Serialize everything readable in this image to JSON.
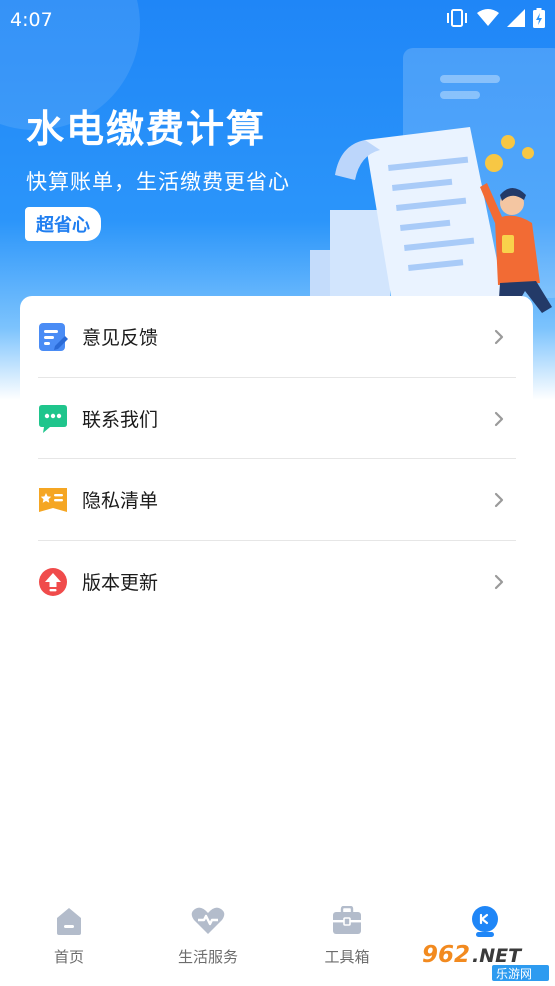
{
  "status_bar": {
    "time": "4:07",
    "icons": [
      "vibrate-icon",
      "wifi-icon",
      "signal-icon",
      "battery-icon"
    ]
  },
  "hero": {
    "title": "水电缴费计算",
    "subtitle": "快算账单，生活缴费更省心",
    "badge": "超省心"
  },
  "menu": {
    "items": [
      {
        "label": "意见反馈",
        "icon": "feedback-icon",
        "color": "#4a8cf5"
      },
      {
        "label": "联系我们",
        "icon": "chat-icon",
        "color": "#1fc58c"
      },
      {
        "label": "隐私清单",
        "icon": "privacy-list-icon",
        "color": "#f5a623"
      },
      {
        "label": "版本更新",
        "icon": "update-icon",
        "color": "#f04b4b"
      }
    ]
  },
  "tabs": [
    {
      "label": "首页",
      "icon": "home-icon"
    },
    {
      "label": "生活服务",
      "icon": "life-service-icon"
    },
    {
      "label": "工具箱",
      "icon": "toolbox-icon"
    },
    {
      "label": "",
      "icon": "profile-icon"
    }
  ],
  "colors": {
    "primary": "#1f86f7",
    "tab_inactive": "#b3bccb",
    "tab_active": "#1f86f7"
  },
  "watermark": {
    "text": "962.NET",
    "sub": "乐游网"
  }
}
